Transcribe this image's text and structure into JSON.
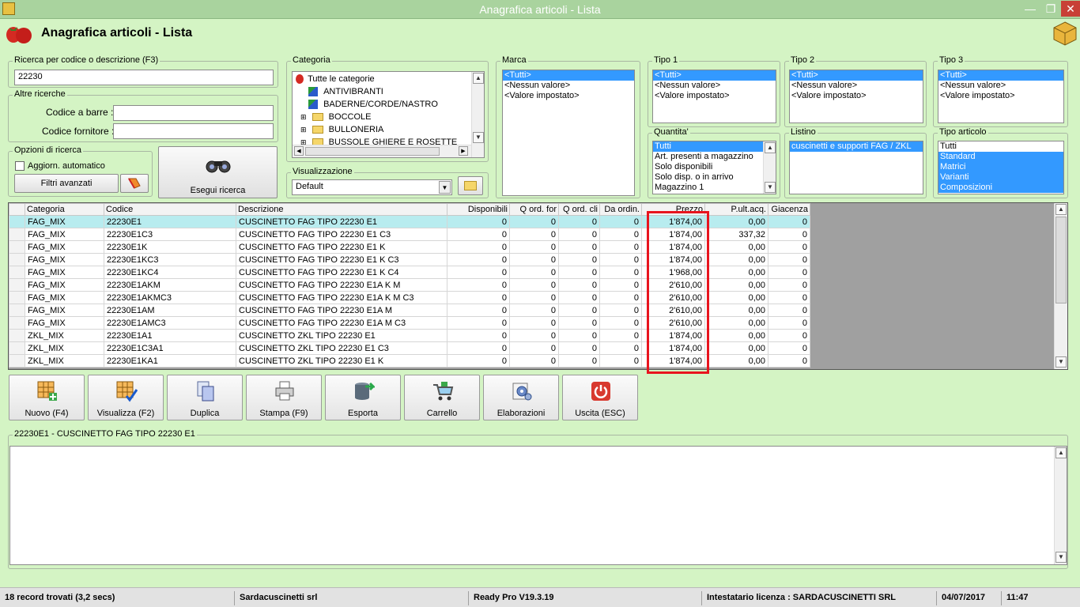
{
  "window": {
    "title": "Anagrafica articoli  - Lista"
  },
  "header": {
    "title": "Anagrafica articoli  - Lista"
  },
  "search": {
    "label": "Ricerca per codice o descrizione (F3)",
    "value": "22230",
    "other_label": "Altre ricerche",
    "barcode_label": "Codice a barre :",
    "supplier_label": "Codice fornitore :",
    "options_label": "Opzioni di ricerca",
    "auto_update_label": "Aggiorn. automatico",
    "advanced_filters_label": "Filtri avanzati",
    "run_search_label": "Esegui ricerca"
  },
  "categoria": {
    "label": "Categoria",
    "items": [
      "Tutte le categorie",
      "ANTIVIBRANTI",
      "BADERNE/CORDE/NASTRO",
      "BOCCOLE",
      "BULLONERIA",
      "BUSSOLE GHIERE E ROSETTE"
    ]
  },
  "visualizzazione": {
    "label": "Visualizzazione",
    "value": "Default"
  },
  "marca": {
    "label": "Marca",
    "items": [
      "<Tutti>",
      "<Nessun valore>",
      "<Valore impostato>"
    ]
  },
  "tipo1": {
    "label": "Tipo 1",
    "items": [
      "<Tutti>",
      "<Nessun valore>",
      "<Valore impostato>"
    ]
  },
  "tipo2": {
    "label": "Tipo 2",
    "items": [
      "<Tutti>",
      "<Nessun valore>",
      "<Valore impostato>"
    ]
  },
  "tipo3": {
    "label": "Tipo 3",
    "items": [
      "<Tutti>",
      "<Nessun valore>",
      "<Valore impostato>"
    ]
  },
  "quantita": {
    "label": "Quantita'",
    "items": [
      "Tutti",
      "Art. presenti a magazzino",
      "Solo disponibili",
      "Solo disp. o in arrivo",
      "Magazzino 1"
    ]
  },
  "listino": {
    "label": "Listino",
    "items": [
      "cuscinetti e supporti FAG / ZKL"
    ]
  },
  "tipo_articolo": {
    "label": "Tipo articolo",
    "items": [
      "Tutti",
      "Standard",
      "Matrici",
      "Varianti",
      "Composizioni"
    ]
  },
  "grid": {
    "columns": [
      "Categoria",
      "Codice",
      "Descrizione",
      "Disponibili",
      "Q ord. for",
      "Q ord. cli",
      "Da ordin.",
      "Prezzo",
      "P.ult.acq.",
      "Giacenza"
    ],
    "rows": [
      [
        "FAG_MIX",
        "22230E1",
        "CUSCINETTO FAG TIPO  22230 E1",
        "0",
        "0",
        "0",
        "0",
        "1'874,00",
        "0,00",
        "0"
      ],
      [
        "FAG_MIX",
        "22230E1C3",
        "CUSCINETTO FAG TIPO  22230 E1 C3",
        "0",
        "0",
        "0",
        "0",
        "1'874,00",
        "337,32",
        "0"
      ],
      [
        "FAG_MIX",
        "22230E1K",
        "CUSCINETTO FAG TIPO  22230 E1 K",
        "0",
        "0",
        "0",
        "0",
        "1'874,00",
        "0,00",
        "0"
      ],
      [
        "FAG_MIX",
        "22230E1KC3",
        "CUSCINETTO FAG TIPO  22230 E1 K C3",
        "0",
        "0",
        "0",
        "0",
        "1'874,00",
        "0,00",
        "0"
      ],
      [
        "FAG_MIX",
        "22230E1KC4",
        "CUSCINETTO FAG TIPO  22230 E1 K C4",
        "0",
        "0",
        "0",
        "0",
        "1'968,00",
        "0,00",
        "0"
      ],
      [
        "FAG_MIX",
        "22230E1AKM",
        "CUSCINETTO FAG TIPO  22230 E1A K M",
        "0",
        "0",
        "0",
        "0",
        "2'610,00",
        "0,00",
        "0"
      ],
      [
        "FAG_MIX",
        "22230E1AKMC3",
        "CUSCINETTO FAG TIPO  22230 E1A K M C3",
        "0",
        "0",
        "0",
        "0",
        "2'610,00",
        "0,00",
        "0"
      ],
      [
        "FAG_MIX",
        "22230E1AM",
        "CUSCINETTO FAG TIPO  22230 E1A M",
        "0",
        "0",
        "0",
        "0",
        "2'610,00",
        "0,00",
        "0"
      ],
      [
        "FAG_MIX",
        "22230E1AMC3",
        "CUSCINETTO FAG TIPO  22230 E1A M C3",
        "0",
        "0",
        "0",
        "0",
        "2'610,00",
        "0,00",
        "0"
      ],
      [
        "ZKL_MIX",
        "22230E1A1",
        "CUSCINETTO ZKL TIPO  22230 E1",
        "0",
        "0",
        "0",
        "0",
        "1'874,00",
        "0,00",
        "0"
      ],
      [
        "ZKL_MIX",
        "22230E1C3A1",
        "CUSCINETTO ZKL TIPO  22230 E1 C3",
        "0",
        "0",
        "0",
        "0",
        "1'874,00",
        "0,00",
        "0"
      ],
      [
        "ZKL_MIX",
        "22230E1KA1",
        "CUSCINETTO ZKL TIPO  22230 E1 K",
        "0",
        "0",
        "0",
        "0",
        "1'874,00",
        "0,00",
        "0"
      ]
    ]
  },
  "toolbar": [
    {
      "label": "Nuovo (F4)",
      "icon": "new-grid-icon"
    },
    {
      "label": "Visualizza (F2)",
      "icon": "view-grid-icon"
    },
    {
      "label": "Duplica",
      "icon": "duplicate-icon"
    },
    {
      "label": "Stampa (F9)",
      "icon": "printer-icon"
    },
    {
      "label": "Esporta",
      "icon": "export-icon"
    },
    {
      "label": "Carrello",
      "icon": "cart-icon"
    },
    {
      "label": "Elaborazioni",
      "icon": "gears-icon"
    },
    {
      "label": "Uscita (ESC)",
      "icon": "power-icon"
    }
  ],
  "details": {
    "label": "22230E1 - CUSCINETTO FAG TIPO  22230 E1"
  },
  "status": {
    "records": "18 record trovati (3,2 secs)",
    "company": "Sardacuscinetti srl",
    "version": "Ready Pro V19.3.19",
    "license": "Intestatario licenza : SARDACUSCINETTI  SRL",
    "date": "04/07/2017",
    "time": "11:47"
  },
  "colors": {
    "background": "#d4f4c4",
    "selection": "#3399ff",
    "selected_row": "#b8ecef",
    "highlight": "#e8141e"
  }
}
